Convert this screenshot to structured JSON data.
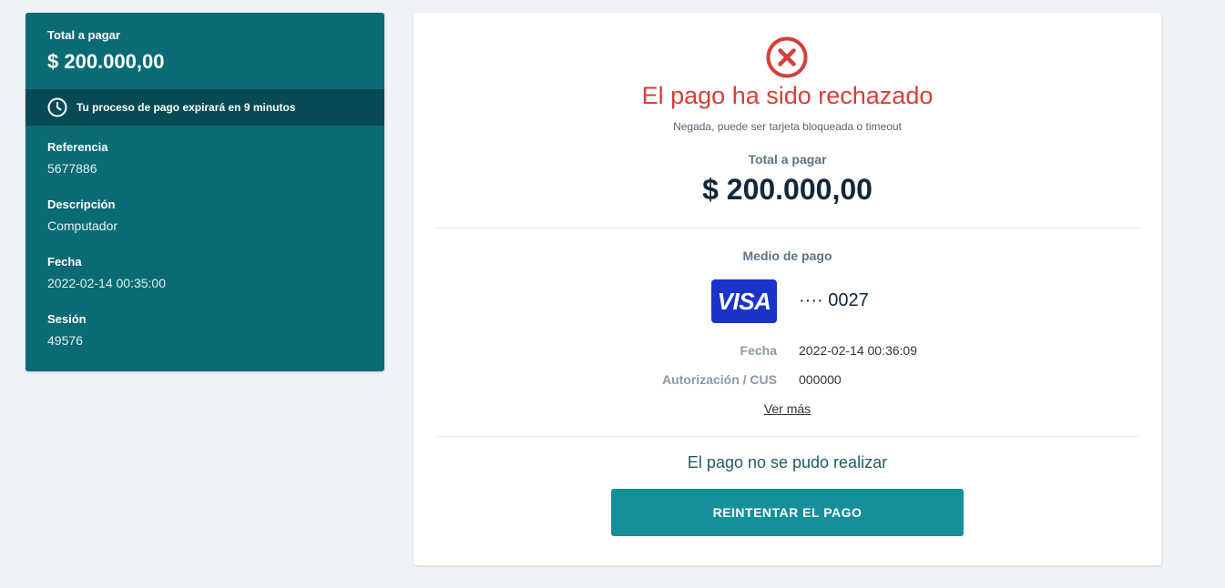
{
  "summary": {
    "total_label": "Total a pagar",
    "total_amount": "$ 200.000,00",
    "timer_text": "Tu proceso de pago expirará en 9 minutos",
    "fields": [
      {
        "label": "Referencia",
        "value": "5677886"
      },
      {
        "label": "Descripción",
        "value": "Computador"
      },
      {
        "label": "Fecha",
        "value": "2022-02-14 00:35:00"
      },
      {
        "label": "Sesión",
        "value": "49576"
      }
    ]
  },
  "result": {
    "status_icon": "x-circle-icon",
    "title": "El pago ha sido rechazado",
    "subtitle": "Negada, puede ser tarjeta bloqueada o timeout",
    "amount_label": "Total a pagar",
    "amount": "$ 200.000,00",
    "method_label": "Medio de pago",
    "card_brand": "VISA",
    "card_number": "···· 0027",
    "details": [
      {
        "label": "Fecha",
        "value": "2022-02-14 00:36:09"
      },
      {
        "label": "Autorización / CUS",
        "value": "000000"
      }
    ],
    "ver_mas": "Ver más",
    "fail_message": "El pago no se pudo realizar",
    "retry_button": "REINTENTAR EL PAGO"
  },
  "colors": {
    "panel": "#0b6b75",
    "timer_bar": "#064b54",
    "error": "#d43f3a",
    "button": "#15909a",
    "visa": "#1a34c9"
  }
}
